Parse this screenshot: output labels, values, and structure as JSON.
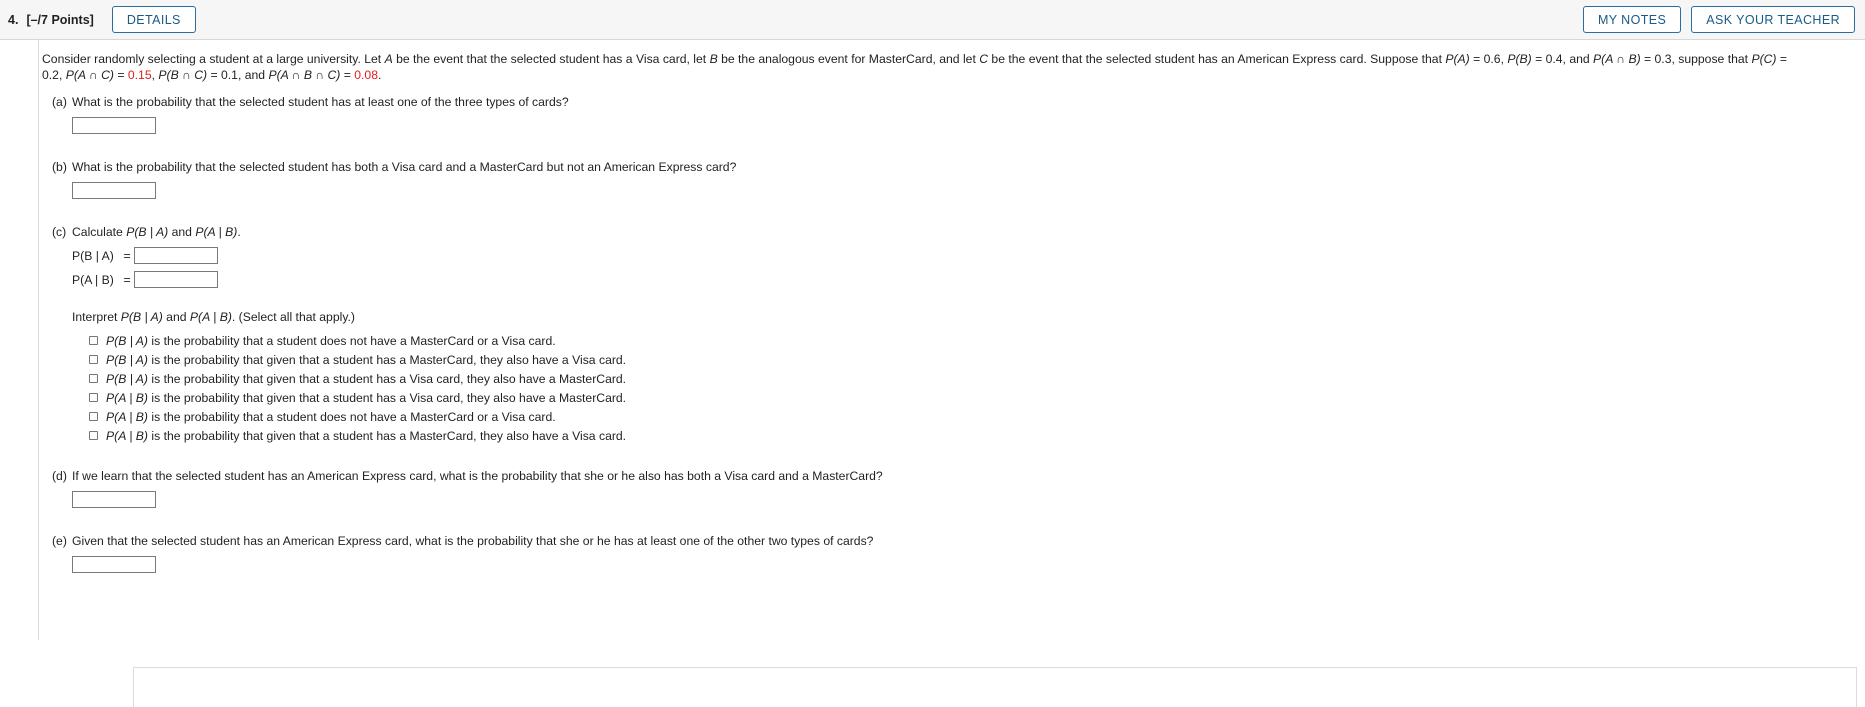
{
  "header": {
    "question_number": "4.",
    "points": "[–/7 Points]",
    "details_label": "DETAILS",
    "my_notes_label": "MY NOTES",
    "ask_your_teacher_label": "ASK YOUR TEACHER"
  },
  "statement": {
    "seg1": "Consider randomly selecting a student at a large university. Let ",
    "varA": "A",
    "seg2": " be the event that the selected student has a Visa card, let ",
    "varB": "B",
    "seg3": " be the analogous event for MasterCard, and let ",
    "varC": "C",
    "seg4": " be the event that the selected student has an American Express card. Suppose that ",
    "pA": "P(A)",
    "pA_val": " = 0.6, ",
    "pB": "P(B)",
    "pB_val": " = 0.4, and ",
    "pAB": "P(A ∩ B)",
    "pAB_val": " = 0.3, suppose that ",
    "pC": "P(C)",
    "pC_val": " = 0.2, ",
    "pAC": "P(A ∩ C)",
    "pAC_eq": " = ",
    "pAC_val": "0.15",
    "pAC_tail": ", ",
    "pBC": "P(B ∩ C)",
    "pBC_val": " = 0.1, and ",
    "pABC": "P(A ∩ B ∩ C)",
    "pABC_eq": " = ",
    "pABC_val": "0.08",
    "pABC_tail": "."
  },
  "parts": {
    "a": {
      "label": "(a)",
      "question": "What is the probability that the selected student has at least one of the three types of cards?",
      "answer": "",
      "placeholder": ""
    },
    "b": {
      "label": "(b)",
      "question": "What is the probability that the selected student has both a Visa card and a MasterCard but not an American Express card?",
      "answer": "",
      "placeholder": ""
    },
    "c": {
      "label": "(c)",
      "question_pre": "Calculate ",
      "question_ba": "P(B | A)",
      "question_mid": " and ",
      "question_ab": "P(A | B)",
      "question_post": ".",
      "eq1_label": "P(B | A)",
      "eq1_eq": "=",
      "eq1_answer": "",
      "eq2_label": "P(A | B)",
      "eq2_eq": "=",
      "eq2_answer": "",
      "interpret_pre": "Interpret ",
      "interpret_ba": "P(B | A)",
      "interpret_mid": " and ",
      "interpret_ab": "P(A | B)",
      "interpret_post": ". (Select all that apply.)",
      "choices": [
        {
          "expr": "P(B | A)",
          "text": " is the probability that a student does not have a MasterCard or a Visa card.",
          "checked": false
        },
        {
          "expr": "P(B | A)",
          "text": " is the probability that given that a student has a MasterCard, they also have a Visa card.",
          "checked": false
        },
        {
          "expr": "P(B | A)",
          "text": " is the probability that given that a student has a Visa card, they also have a MasterCard.",
          "checked": false
        },
        {
          "expr": "P(A | B)",
          "text": " is the probability that given that a student has a Visa card, they also have a MasterCard.",
          "checked": false
        },
        {
          "expr": "P(A | B)",
          "text": " is the probability that a student does not have a MasterCard or a Visa card.",
          "checked": false
        },
        {
          "expr": "P(A | B)",
          "text": " is the probability that given that a student has a MasterCard, they also have a Visa card.",
          "checked": false
        }
      ]
    },
    "d": {
      "label": "(d)",
      "question": "If we learn that the selected student has an American Express card, what is the probability that she or he also has both a Visa card and a MasterCard?",
      "answer": "",
      "placeholder": ""
    },
    "e": {
      "label": "(e)",
      "question": "Given that the selected student has an American Express card, what is the probability that she or he has at least one of the other two types of cards?",
      "answer": "",
      "placeholder": ""
    }
  },
  "colors": {
    "accent": "#1a5a87",
    "highlight": "#e02020",
    "header_bg": "#f6f6f6"
  }
}
